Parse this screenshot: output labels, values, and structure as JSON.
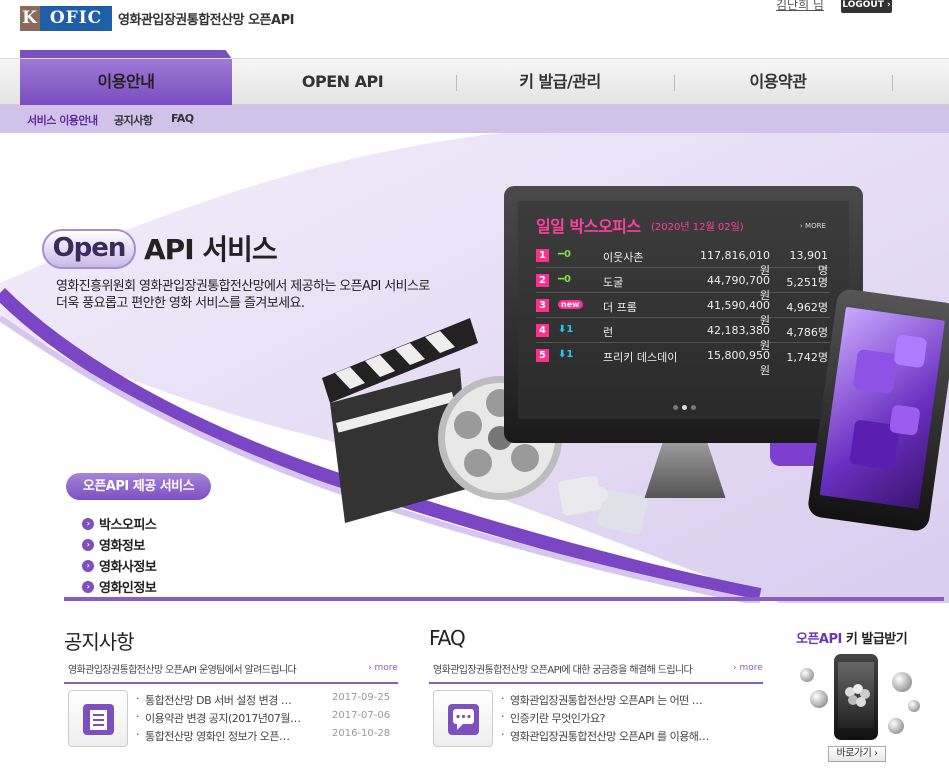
{
  "header": {
    "logo_k": "K",
    "logo_rest": "OFIC",
    "site_title": "영화관입장권통합전산망 오픈API",
    "user_name": "김난희 님",
    "logout_label": "LOGOUT ›"
  },
  "gnb": {
    "items": [
      {
        "label": "이용안내"
      },
      {
        "label": "OPEN API"
      },
      {
        "label": "키 발급/관리"
      },
      {
        "label": "이용약관"
      }
    ]
  },
  "subnav": {
    "items": [
      {
        "label": "서비스 이용안내"
      },
      {
        "label": "공지사항"
      },
      {
        "label": "FAQ"
      }
    ]
  },
  "hero": {
    "open_label": "Open",
    "api_service": "API 서비스",
    "desc_line1": "영화진흥위원회 영화관입장권통합전산망에서 제공하는 오픈API 서비스로",
    "desc_line2": "더욱 풍요롭고 편안한 영화 서비스를 즐겨보세요.",
    "services_title": "오픈API 제공 서비스",
    "services": [
      {
        "label": "박스오피스"
      },
      {
        "label": "영화정보"
      },
      {
        "label": "영화사정보"
      },
      {
        "label": "영화인정보"
      }
    ]
  },
  "boxoffice": {
    "title": "일일 박스오피스",
    "date": "(2020년 12월 02일)",
    "more": "› MORE",
    "rows": [
      {
        "rank": "1",
        "change": "━0",
        "name": "이웃사촌",
        "sales": "117,816,010원",
        "audience": "13,901명"
      },
      {
        "rank": "2",
        "change": "━0",
        "name": "도굴",
        "sales": "44,790,700원",
        "audience": "5,251명"
      },
      {
        "rank": "3",
        "change": "new",
        "name": "더 프롬",
        "sales": "41,590,400원",
        "audience": "4,962명"
      },
      {
        "rank": "4",
        "change": "⬇1",
        "name": "런",
        "sales": "42,183,380원",
        "audience": "4,786명"
      },
      {
        "rank": "5",
        "change": "⬇1",
        "name": "프리키 데스데이",
        "sales": "15,800,950원",
        "audience": "1,742명"
      }
    ]
  },
  "notice": {
    "title": "공지사항",
    "subtitle": "영화관입장권통합전산망 오픈API 운영팀에서 알려드립니다",
    "more": "› more",
    "items": [
      {
        "text": "통합전산망 DB 서버 설정 변경 …",
        "date": "2017-09-25"
      },
      {
        "text": "이용약관 변경 공지(2017년07월…",
        "date": "2017-07-06"
      },
      {
        "text": "통합전산망 영화인 정보가 오픈…",
        "date": "2016-10-28"
      }
    ]
  },
  "faq": {
    "title": "FAQ",
    "subtitle": "영화관입장권통합전산망 오픈API에 대한 궁금증을 해결해 드립니다",
    "more": "› more",
    "items": [
      {
        "text": "영화관입장권통합전산망 오픈API 는 어떤 …"
      },
      {
        "text": "인증키란 무엇인가요?"
      },
      {
        "text": "영화관입장권통합전산망 오픈API 를 이용해…"
      }
    ]
  },
  "keybox": {
    "title_highlight": "오픈API",
    "title_rest": " 키 발급받기",
    "button": "바로가기 ›"
  },
  "colors": {
    "accent": "#7d4fbf",
    "subnav_bg": "#d1c2ea",
    "rank_pink": "#ff2f8e",
    "change_green": "#7fe04a",
    "change_cyan": "#2ec7e8"
  }
}
